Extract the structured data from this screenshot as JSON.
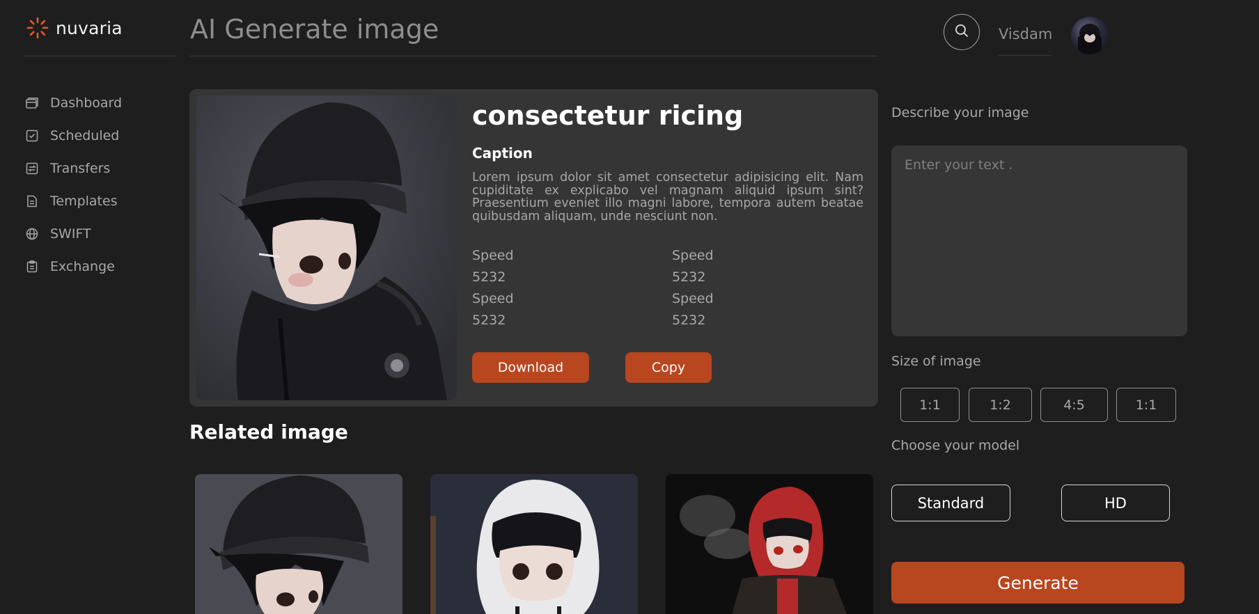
{
  "brand": {
    "name": "nuvaria",
    "accent": "#e8582a"
  },
  "sidebar": {
    "items": [
      {
        "label": "Dashboard",
        "icon": "dashboard-icon"
      },
      {
        "label": "Scheduled",
        "icon": "calendar-check-icon"
      },
      {
        "label": "Transfers",
        "icon": "transfer-icon"
      },
      {
        "label": "Templates",
        "icon": "document-icon"
      },
      {
        "label": "SWIFT",
        "icon": "globe-icon"
      },
      {
        "label": "Exchange",
        "icon": "clipboard-icon"
      }
    ]
  },
  "header": {
    "title": "AI Generate image",
    "search_icon": "search-icon",
    "username": "Visdam"
  },
  "feature": {
    "title": "consectetur ricing",
    "caption_heading": "Caption",
    "caption_text": "Lorem ipsum dolor sit amet consectetur adipisicing elit. Nam cupiditate ex explicabo vel magnam aliquid ipsum sint? Praesentium eveniet illo magni labore, tempora autem beatae quibusdam aliquam, unde nesciunt non.",
    "stats": [
      {
        "label": "Speed",
        "value": "5232"
      },
      {
        "label": "Speed",
        "value": "5232"
      },
      {
        "label": "Speed",
        "value": "5232"
      },
      {
        "label": "Speed",
        "value": "5232"
      }
    ],
    "download_label": "Download",
    "copy_label": "Copy"
  },
  "related": {
    "title": "Related image"
  },
  "panel": {
    "describe_label": "Describe your image",
    "describe_placeholder": "Enter your text .",
    "size_label": "Size of image",
    "sizes": [
      "1:1",
      "1:2",
      "4:5",
      "1:1"
    ],
    "model_label": "Choose your model",
    "models": [
      "Standard",
      "HD"
    ],
    "generate_label": "Generate"
  },
  "colors": {
    "background": "#1e1e1f",
    "card": "#363536",
    "button": "#b8461f"
  }
}
